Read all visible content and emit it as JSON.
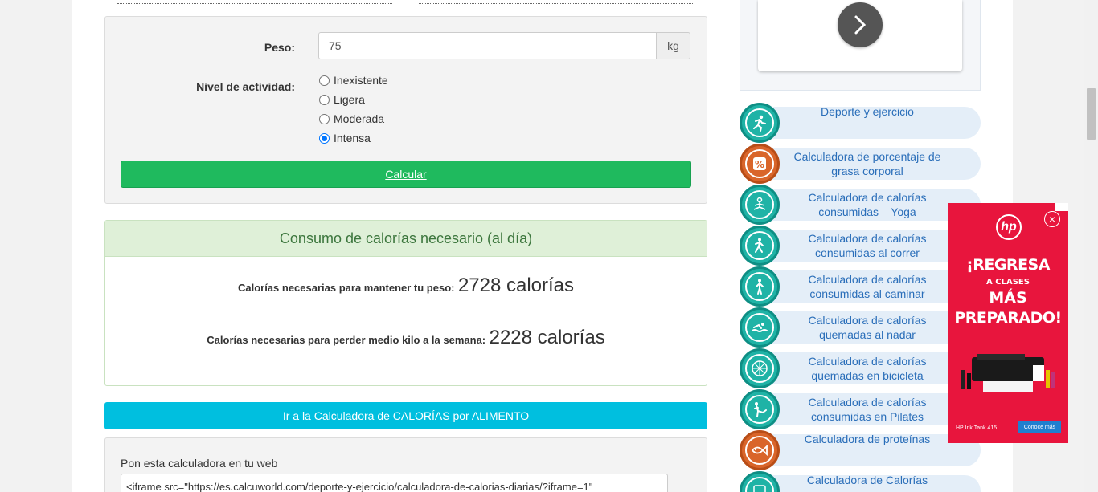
{
  "form": {
    "peso_label": "Peso:",
    "peso_value": "75",
    "peso_unit": "kg",
    "nivel_label": "Nivel de actividad:",
    "activity_options": [
      "Inexistente",
      "Ligera",
      "Moderada",
      "Intensa"
    ],
    "selected_activity": "Intensa",
    "calc_button": "Calcular"
  },
  "results": {
    "title": "Consumo de calorías necesario (al día)",
    "maintain_label": "Calorías necesarias para mantener tu peso:",
    "maintain_value": "2728 calorías",
    "lose_label": "Calorías necesarias para perder medio kilo a la semana:",
    "lose_value": "2228 calorías"
  },
  "food_link": "Ir a la Calculadora de CALORÍAS por ALIMENTO",
  "embed": {
    "label": "Pon esta calculadora en tu web",
    "code": "<iframe src=\"https://es.calcuworld.com/deporte-y-ejercicio/calculadora-de-calorias-diarias/?iframe=1\""
  },
  "sidebar": {
    "items": [
      {
        "label": "Deporte y ejercicio",
        "icon": "runner-icon",
        "color": "teal"
      },
      {
        "label": "Calculadora de porcentaje de grasa corporal",
        "icon": "percent-icon",
        "color": "orange"
      },
      {
        "label": "Calculadora de calorías consumidas – Yoga",
        "icon": "yoga-icon",
        "color": "teal"
      },
      {
        "label": "Calculadora de calorías consumidas al correr",
        "icon": "running-icon",
        "color": "teal"
      },
      {
        "label": "Calculadora de calorías consumidas al caminar",
        "icon": "walking-icon",
        "color": "teal"
      },
      {
        "label": "Calculadora de calorías quemadas al nadar",
        "icon": "swimming-icon",
        "color": "teal"
      },
      {
        "label": "Calculadora de calorías quemadas en bicicleta",
        "icon": "bicycle-wheel-icon",
        "color": "teal"
      },
      {
        "label": "Calculadora de calorías consumidas en Pilates",
        "icon": "pilates-icon",
        "color": "teal"
      },
      {
        "label": "Calculadora de proteínas",
        "icon": "fish-icon",
        "color": "orange"
      },
      {
        "label": "Calculadora de Calorías",
        "icon": "kcal-icon",
        "color": "teal"
      }
    ]
  },
  "ad": {
    "brand": "hp",
    "line1": "¡REGRESA",
    "line2": "A CLASES",
    "line3": "MÁS",
    "line4": "PREPARADO!",
    "product": "HP Ink Tank 415",
    "cta": "Conoce más",
    "close": "×"
  },
  "colors": {
    "green_button": "#1fba5e",
    "cyan_button": "#00bfdf",
    "sidebar_link": "#2a6eb9",
    "ad_background": "#e8153d"
  }
}
